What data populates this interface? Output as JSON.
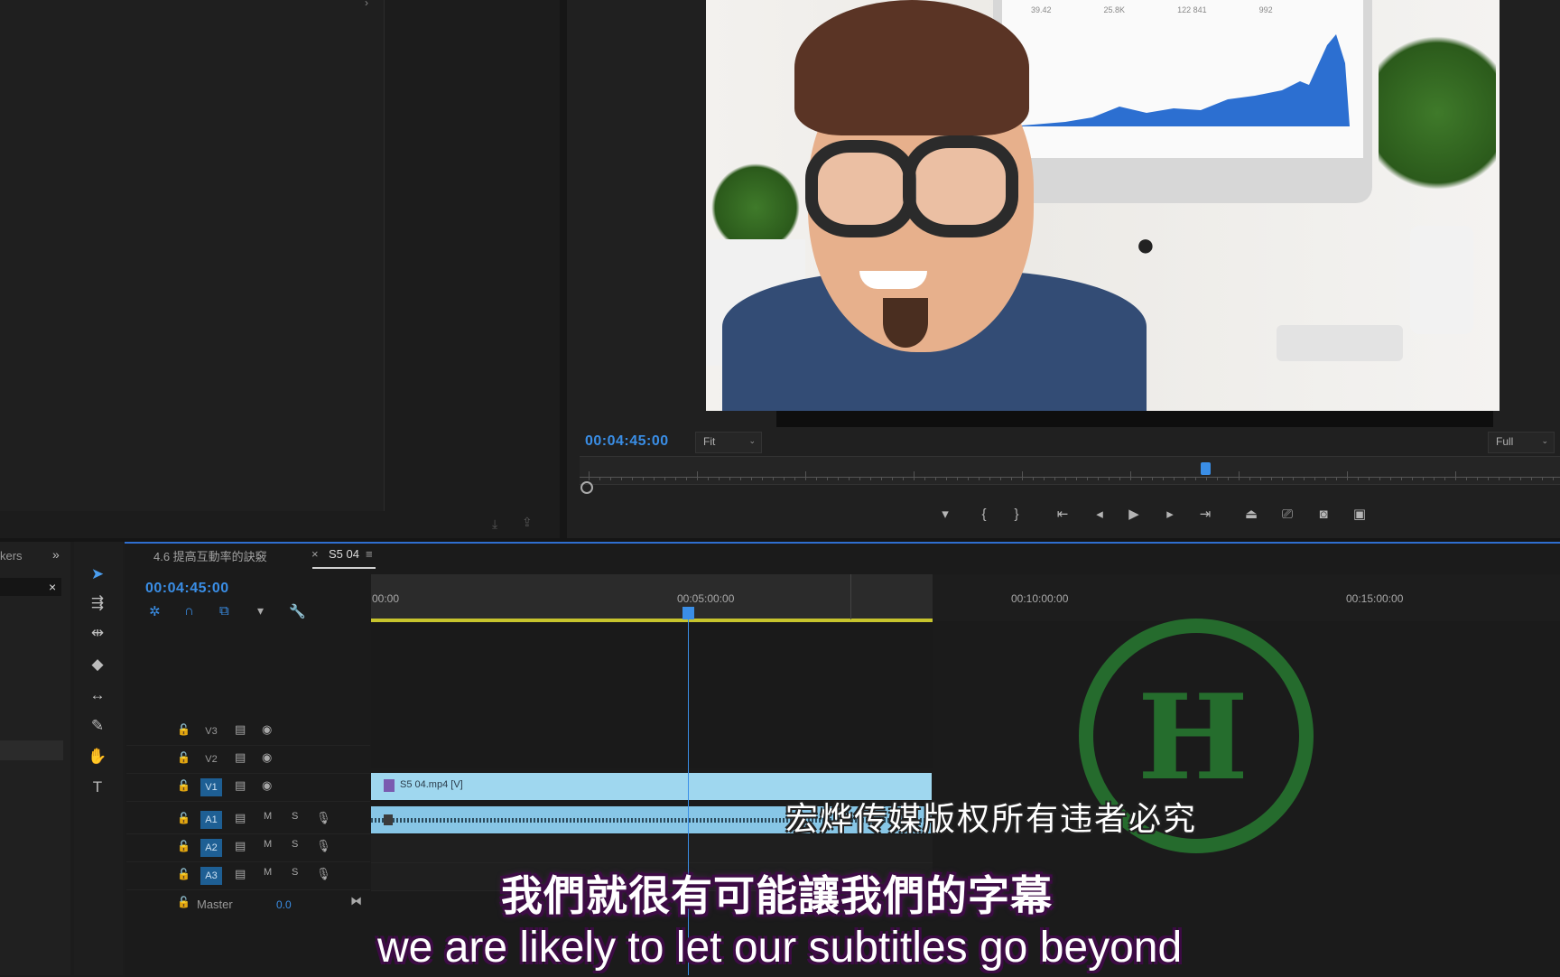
{
  "program": {
    "timecode": "00:04:45:00",
    "zoom_select": "Fit",
    "quality_select": "Full"
  },
  "video_overlay": {
    "chart_stats": [
      "39.42",
      "25.8K",
      "122 841",
      "992"
    ]
  },
  "timeline": {
    "project_tab_fragment": "kers",
    "sequence_tab": "4.6 提高互動率的訣竅",
    "active_tab": "S5 04",
    "timecode": "00:04:45:00",
    "ruler": [
      "00:00",
      "00:05:00:00",
      "00:10:00:00",
      "00:15:00:00"
    ],
    "tracks": {
      "v3": "V3",
      "v2": "V2",
      "v1": "V1",
      "a1": "A1",
      "a2": "A2",
      "a3": "A3",
      "master": "Master",
      "master_value": "0.0",
      "m": "M",
      "s": "S"
    },
    "v1_clip": "S5 04.mp4 [V]"
  },
  "overlay": {
    "copyright": "宏烨传媒版权所有违者必究",
    "subtitle_zh": "我們就很有可能讓我們的字幕",
    "subtitle_en": "we are likely to let our subtitles go beyond"
  },
  "colors": {
    "accent": "#3a8ee6",
    "work_area": "#c7c42d",
    "v1_clip": "#9fd7ef",
    "watermark": "#28823a"
  }
}
